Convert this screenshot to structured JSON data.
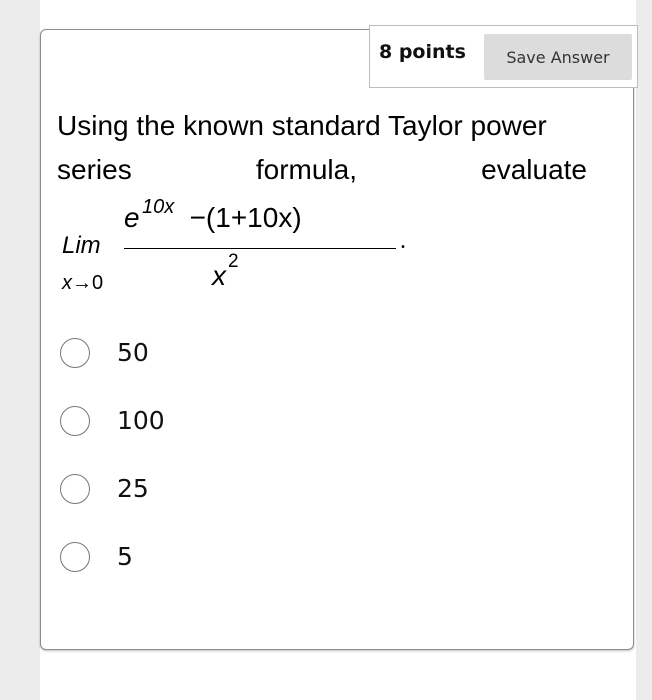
{
  "header": {
    "points_label": "8 points",
    "save_button_label": "Save Answer"
  },
  "question": {
    "line1": "Using the known standard Taylor power",
    "line2_words": [
      "series",
      "formula,",
      "evaluate"
    ]
  },
  "math": {
    "lim": "Lim",
    "subscript_var": "x",
    "subscript_arrow": "→",
    "subscript_target": "0",
    "numerator_base": "e",
    "numerator_exponent": "10x",
    "numerator_rest": "−(1+10x)",
    "denominator_base": "x",
    "denominator_exponent": "2",
    "trailing": "."
  },
  "options": [
    {
      "label": "50",
      "selected": false
    },
    {
      "label": "100",
      "selected": false
    },
    {
      "label": "25",
      "selected": false
    },
    {
      "label": "5",
      "selected": false
    }
  ],
  "colors": {
    "save_button_bg": "#dcdcdc",
    "card_border": "#8c8c8c",
    "background": "#ececec"
  }
}
